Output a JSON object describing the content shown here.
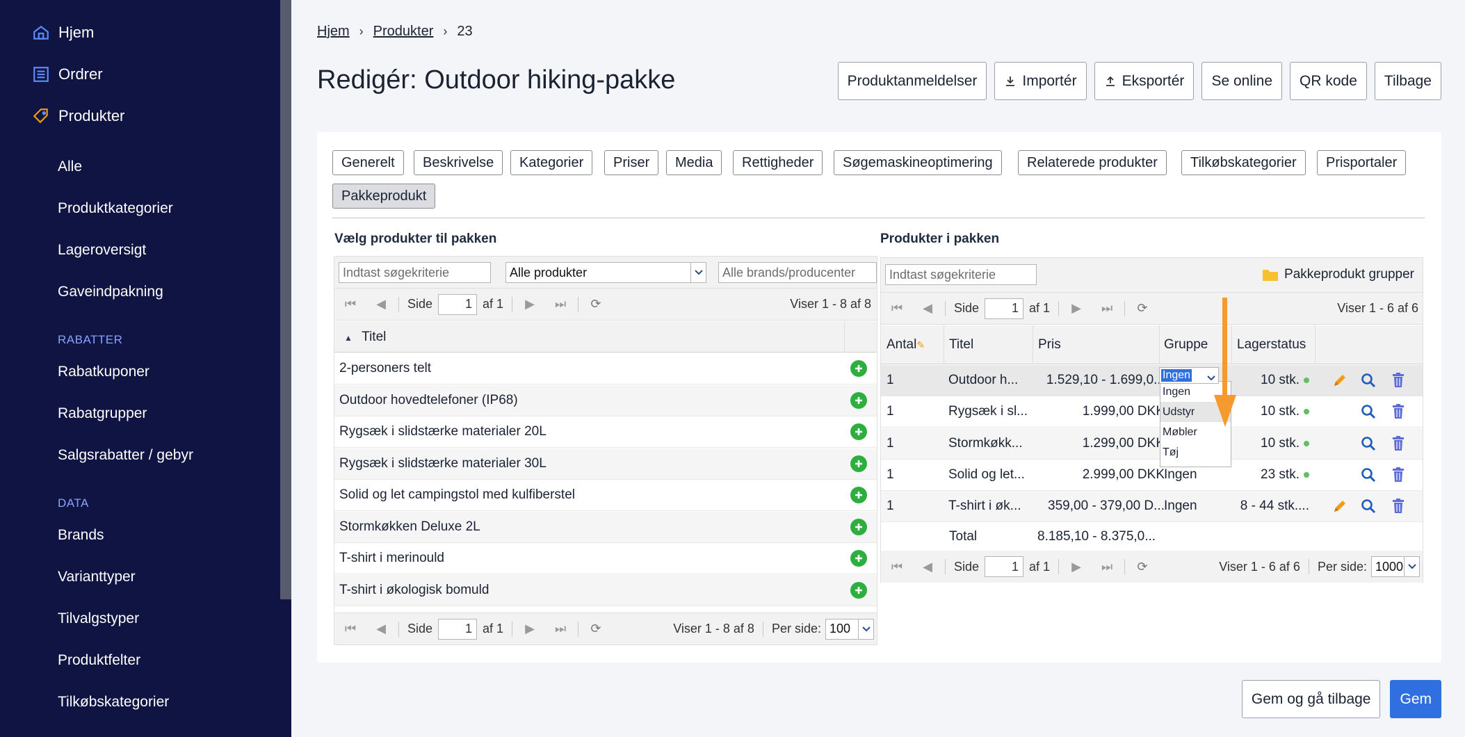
{
  "sidebar": {
    "top_items": [
      {
        "label": "Hjem",
        "icon": "home-icon"
      },
      {
        "label": "Ordrer",
        "icon": "orders-icon"
      },
      {
        "label": "Produkter",
        "icon": "tag-icon"
      }
    ],
    "products_sub": [
      "Alle",
      "Produktkategorier",
      "Lageroversigt",
      "Gaveindpakning"
    ],
    "discounts_heading": "RABATTER",
    "discounts": [
      "Rabatkuponer",
      "Rabatgrupper",
      "Salgsrabatter / gebyr"
    ],
    "data_heading": "DATA",
    "data_items": [
      "Brands",
      "Varianttyper",
      "Tilvalgstyper",
      "Produktfelter",
      "Tilkøbskategorier"
    ]
  },
  "breadcrumb": [
    "Hjem",
    "Produkter",
    "23"
  ],
  "page_title": "Redigér: Outdoor hiking-pakke",
  "top_actions": [
    "Produktanmeldelser",
    "Importér",
    "Eksportér",
    "Se online",
    "QR kode",
    "Tilbage"
  ],
  "tabs": [
    "Generelt",
    "Beskrivelse",
    "Kategorier",
    "Priser",
    "Media",
    "Rettigheder",
    "Søgemaskineoptimering",
    "Relaterede produkter",
    "Tilkøbskategorier",
    "Prisportaler",
    "Pakkeprodukt"
  ],
  "left": {
    "title": "Vælg produkter til pakken",
    "search_placeholder": "Indtast søgekriterie",
    "filter_value": "Alle produkter",
    "brand_placeholder": "Alle brands/producenter",
    "pager_side": "Side",
    "page": "1",
    "of": "af 1",
    "showing_top": "Viser 1 - 8 af 8",
    "column_title": "Titel",
    "rows": [
      "2-personers telt",
      "Outdoor hovedtelefoner (IP68)",
      "Rygsæk i slidstærke materialer 20L",
      "Rygsæk i slidstærke materialer 30L",
      "Solid og let campingstol med kulfiberstel",
      "Stormkøkken Deluxe 2L",
      "T-shirt i merinould",
      "T-shirt i økologisk bomuld"
    ],
    "showing_bottom": "Viser 1 - 8 af 8",
    "per_page_label": "Per side:",
    "per_page": "100"
  },
  "right": {
    "title": "Produkter i pakken",
    "search_placeholder": "Indtast søgekriterie",
    "groups_link": "Pakkeprodukt grupper",
    "pager_side": "Side",
    "page": "1",
    "of": "af 1",
    "showing_top": "Viser 1 - 6 af 6",
    "columns": [
      "Antal",
      "Titel",
      "Pris",
      "Gruppe",
      "Lagerstatus"
    ],
    "rows": [
      {
        "qty": "1",
        "title": "Outdoor h...",
        "price": "1.529,10 - 1.699,0...",
        "group": "Ingen",
        "stock": "10 stk."
      },
      {
        "qty": "1",
        "title": "Rygsæk i sl...",
        "price": "1.999,00 DKK",
        "group": "",
        "stock": "10 stk."
      },
      {
        "qty": "1",
        "title": "Stormkøkk...",
        "price": "1.299,00 DKK",
        "group": "",
        "stock": "10 stk."
      },
      {
        "qty": "1",
        "title": "Solid og let...",
        "price": "2.999,00 DKK",
        "group": "Ingen",
        "stock": "23 stk."
      },
      {
        "qty": "1",
        "title": "T-shirt i øk...",
        "price": "359,00 - 379,00 D...",
        "group": "Ingen",
        "stock": "8 - 44 stk...."
      }
    ],
    "total_label": "Total",
    "total_value": "8.185,10 - 8.375,0...",
    "group_options": [
      "Ingen",
      "Udstyr",
      "Møbler",
      "Tøj"
    ],
    "showing_bottom": "Viser 1 - 6 af 6",
    "per_page_label": "Per side:",
    "per_page": "1000"
  },
  "bottom_actions": [
    "Gem og gå tilbage",
    "Gem"
  ],
  "colors": {
    "sidebar_bg": "#0f1442",
    "primary": "#2f6fe0",
    "add": "#2eae3f",
    "edit": "#f39c12",
    "delete": "#5c6bd6",
    "arrow": "#f59a2e"
  }
}
